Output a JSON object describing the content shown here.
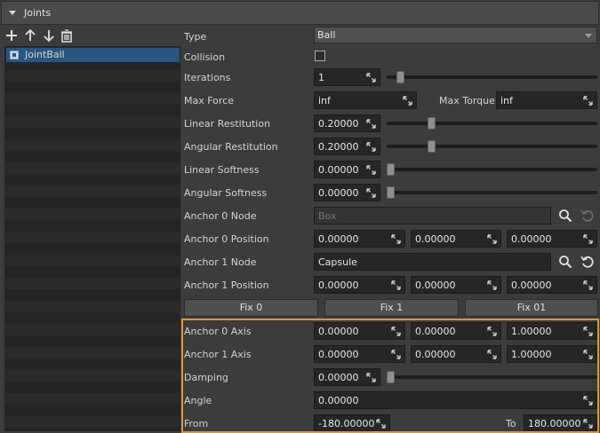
{
  "section": {
    "title": "Joints"
  },
  "toolbar": {
    "add_icon": "plus-icon",
    "up_icon": "arrow-up-icon",
    "down_icon": "arrow-down-icon",
    "delete_icon": "trash-icon"
  },
  "joint_list": {
    "items": [
      {
        "label": "JointBall",
        "enabled": true
      }
    ]
  },
  "props": {
    "type": {
      "label": "Type",
      "value": "Ball"
    },
    "collision": {
      "label": "Collision",
      "checked": false
    },
    "iterations": {
      "label": "Iterations",
      "value": "1",
      "slider": 0.05
    },
    "max_force": {
      "label": "Max Force",
      "value": "inf"
    },
    "max_torque": {
      "label": "Max Torque",
      "value": "inf"
    },
    "linear_restitution": {
      "label": "Linear Restitution",
      "value": "0.20000",
      "slider": 0.2
    },
    "angular_restitution": {
      "label": "Angular Restitution",
      "value": "0.20000",
      "slider": 0.2
    },
    "linear_softness": {
      "label": "Linear Softness",
      "value": "0.00000",
      "slider": 0
    },
    "angular_softness": {
      "label": "Angular Softness",
      "value": "0.00000",
      "slider": 0
    },
    "anchor0_node": {
      "label": "Anchor 0 Node",
      "placeholder": "Box"
    },
    "anchor0_position": {
      "label": "Anchor 0 Position",
      "x": "0.00000",
      "y": "0.00000",
      "z": "0.00000"
    },
    "anchor1_node": {
      "label": "Anchor 1 Node",
      "value": "Capsule"
    },
    "anchor1_position": {
      "label": "Anchor 1 Position",
      "x": "0.00000",
      "y": "0.00000",
      "z": "0.00000"
    }
  },
  "buttons": {
    "fix0": "Fix 0",
    "fix1": "Fix 1",
    "fix01": "Fix 01"
  },
  "ball": {
    "anchor0_axis": {
      "label": "Anchor 0 Axis",
      "x": "0.00000",
      "y": "0.00000",
      "z": "1.00000"
    },
    "anchor1_axis": {
      "label": "Anchor 1 Axis",
      "x": "0.00000",
      "y": "0.00000",
      "z": "1.00000"
    },
    "damping": {
      "label": "Damping",
      "value": "0.00000",
      "slider": 0
    },
    "angle": {
      "label": "Angle",
      "value": "0.00000"
    },
    "from": {
      "label": "From",
      "value": "-180.00000"
    },
    "to": {
      "label": "To",
      "value": "180.00000"
    }
  },
  "colors": {
    "highlight": "#e8922a",
    "selection": "#2a5580"
  }
}
